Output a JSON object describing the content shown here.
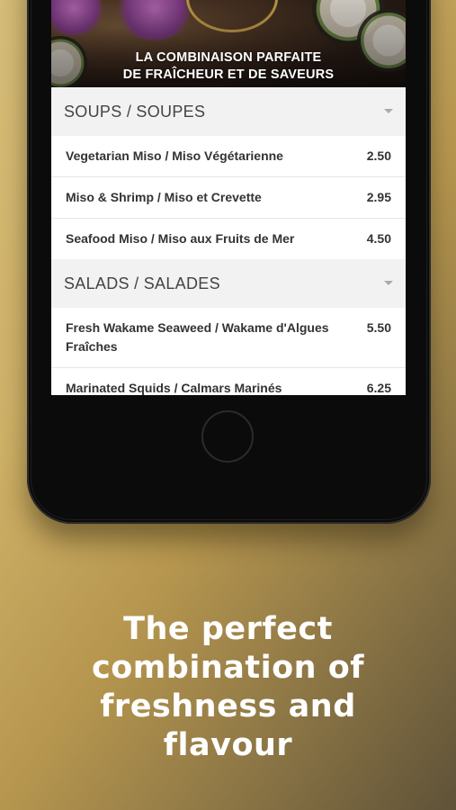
{
  "hero": {
    "line1": "LA COMBINAISON PARFAITE",
    "line2": "DE FRAÎCHEUR ET DE SAVEURS"
  },
  "sections": [
    {
      "title": "SOUPS / SOUPES",
      "items": [
        {
          "name": "Vegetarian Miso / Miso Végétarienne",
          "price": "2.50"
        },
        {
          "name": "Miso & Shrimp / Miso et Crevette",
          "price": "2.95"
        },
        {
          "name": "Seafood Miso / Miso aux Fruits de Mer",
          "price": "4.50"
        }
      ]
    },
    {
      "title": "SALADS / SALADES",
      "items": [
        {
          "name": "Fresh Wakame Seaweed / Wakame d'Algues Fraîches",
          "price": "5.50"
        },
        {
          "name": "Marinated Squids / Calmars Marinés",
          "price": "6.25"
        }
      ]
    }
  ],
  "tagline": {
    "line1": "The perfect",
    "line2": "combination of",
    "line3": "freshness and",
    "line4": "flavour"
  }
}
